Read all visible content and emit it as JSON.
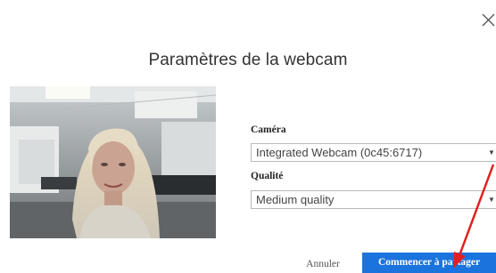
{
  "dialog": {
    "title": "Paramètres de la webcam",
    "close_icon": "close-icon"
  },
  "camera": {
    "label": "Caméra",
    "selected": "Integrated Webcam (0c45:6717)"
  },
  "quality": {
    "label": "Qualité",
    "selected": "Medium quality"
  },
  "actions": {
    "cancel_label": "Annuler",
    "start_label": "Commencer à partager"
  },
  "colors": {
    "primary_button": "#1b73dd",
    "annotation_arrow": "#e02020"
  }
}
